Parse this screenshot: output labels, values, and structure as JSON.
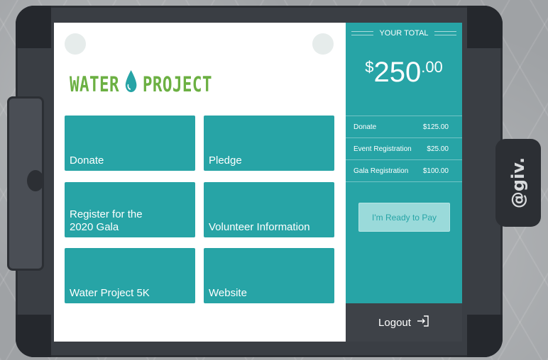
{
  "brand": {
    "logo_left": "WATER",
    "logo_right": "PROJECT",
    "logo_color": "#6cb043",
    "device_brand": "@giv."
  },
  "tiles": [
    {
      "label": "Donate"
    },
    {
      "label": "Pledge"
    },
    {
      "label": "Register for the\n2020 Gala"
    },
    {
      "label": "Volunteer Information"
    },
    {
      "label": "Water Project 5K"
    },
    {
      "label": "Website"
    }
  ],
  "summary": {
    "title": "YOUR TOTAL",
    "currency": "$",
    "amount_whole": "250",
    "amount_cents": ".00",
    "items": [
      {
        "label": "Donate",
        "amount": "$125.00"
      },
      {
        "label": "Event Registration",
        "amount": "$25.00"
      },
      {
        "label": "Gala Registration",
        "amount": "$100.00"
      }
    ],
    "pay_button": "I'm Ready to Pay",
    "logout_label": "Logout"
  },
  "colors": {
    "accent": "#27a4a6",
    "pay_button_bg": "#9adada",
    "logout_bg": "#3e4248"
  },
  "icons": {
    "logout": "logout-icon",
    "drop": "water-drop-icon"
  }
}
